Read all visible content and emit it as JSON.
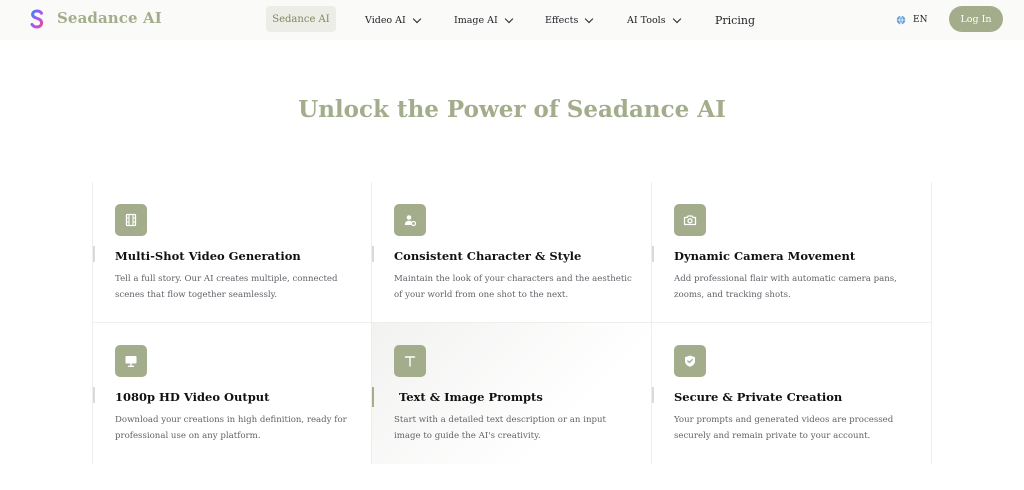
{
  "header": {
    "logo_letter": "S",
    "brand": "Seadance AI",
    "nav": {
      "home": "Sedance AI",
      "video_ai": "Video AI",
      "image_ai": "Image AI",
      "effects": "Effects",
      "ai_tools": "AI Tools",
      "pricing": "Pricing"
    },
    "language": "EN",
    "login": "Log In"
  },
  "main": {
    "title": "Unlock the Power of Seadance AI",
    "features": [
      {
        "icon": "film-icon",
        "title": "Multi-Shot Video Generation",
        "desc": "Tell a full story. Our AI creates multiple, connected scenes that flow together seamlessly."
      },
      {
        "icon": "user-settings-icon",
        "title": "Consistent Character & Style",
        "desc": "Maintain the look of your characters and the aesthetic of your world from one shot to the next."
      },
      {
        "icon": "camera-icon",
        "title": "Dynamic Camera Movement",
        "desc": "Add professional flair with automatic camera pans, zooms, and tracking shots."
      },
      {
        "icon": "monitor-icon",
        "title": "1080p HD Video Output",
        "desc": "Download your creations in high definition, ready for professional use on any platform."
      },
      {
        "icon": "text-icon",
        "title": "Text & Image Prompts",
        "desc": "Start with a detailed text description or an input image to guide the AI's creativity."
      },
      {
        "icon": "shield-check-icon",
        "title": "Secure & Private Creation",
        "desc": "Your prompts and generated videos are processed securely and remain private to your account."
      }
    ]
  },
  "colors": {
    "accent": "#a3ad8c",
    "accent_text": "#7d8a63",
    "nav_active_bg": "#ecede6",
    "logo_gradient": [
      "#3b82f6",
      "#a855f7",
      "#ec4899"
    ]
  }
}
